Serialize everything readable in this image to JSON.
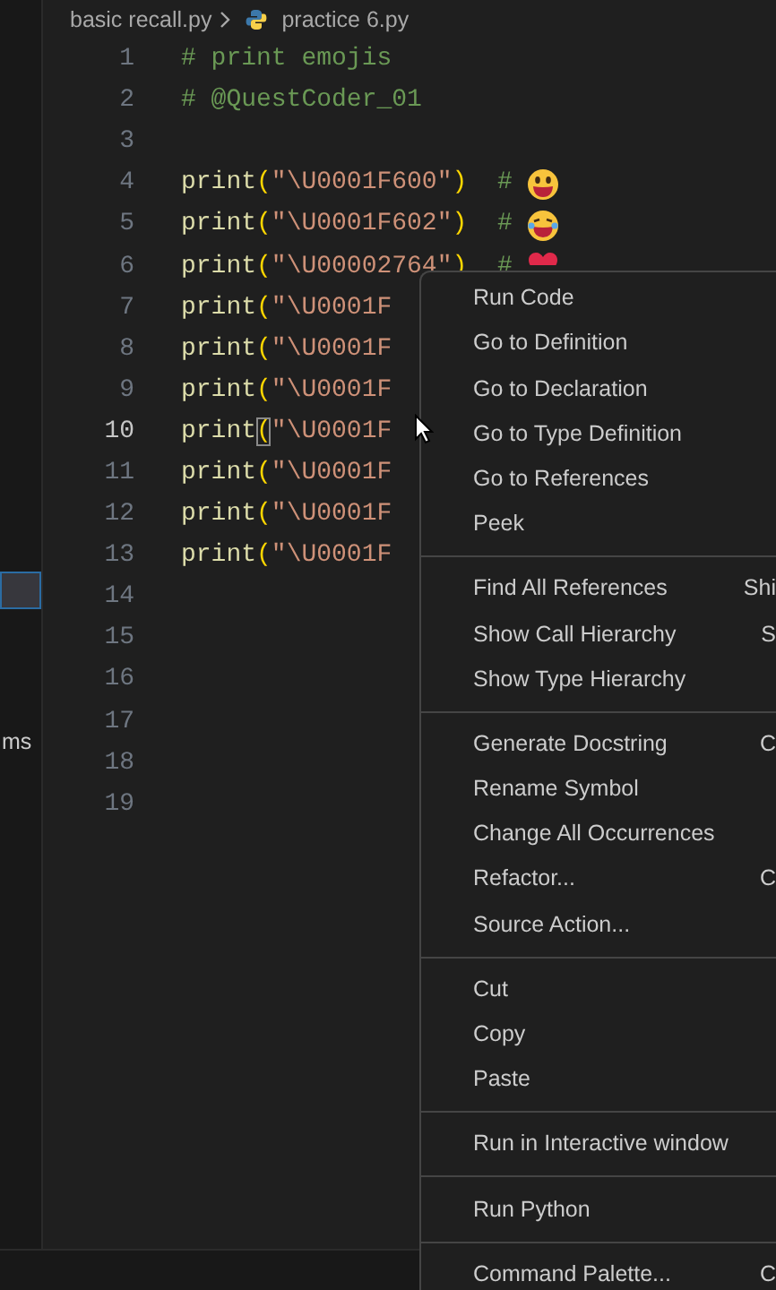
{
  "breadcrumb": {
    "folder": "basic recall.py",
    "file": "practice 6.py"
  },
  "sidebar": {
    "highlighted_row": true,
    "items": [
      {
        "label": "ms"
      }
    ]
  },
  "editor": {
    "lines": [
      {
        "number": "1",
        "current": false,
        "tokens": [
          {
            "kind": "comment",
            "text": "# print emojis"
          }
        ]
      },
      {
        "number": "2",
        "current": false,
        "tokens": [
          {
            "kind": "comment",
            "text": "# @QuestCoder_01"
          }
        ]
      },
      {
        "number": "3",
        "current": false
      },
      {
        "number": "4",
        "current": false,
        "kind": "grin",
        "tokens": [
          {
            "kind": "function",
            "text": "print"
          },
          {
            "kind": "bracket",
            "text": "("
          },
          {
            "kind": "string",
            "text": "\"\\U0001F600\""
          },
          {
            "kind": "bracket",
            "text": ")"
          },
          {
            "kind": "comment",
            "text": "  #"
          }
        ]
      },
      {
        "number": "5",
        "current": false,
        "kind": "joy",
        "tokens": [
          {
            "kind": "function",
            "text": "print"
          },
          {
            "kind": "bracket",
            "text": "("
          },
          {
            "kind": "string",
            "text": "\"\\U0001F602\""
          },
          {
            "kind": "bracket",
            "text": ")"
          },
          {
            "kind": "comment",
            "text": "  #"
          }
        ]
      },
      {
        "number": "6",
        "current": false,
        "kind": "heart",
        "tokens": [
          {
            "kind": "function",
            "text": "print"
          },
          {
            "kind": "bracket",
            "text": "("
          },
          {
            "kind": "string",
            "text": "\"\\U00002764\""
          },
          {
            "kind": "bracket",
            "text": ")"
          },
          {
            "kind": "comment",
            "text": "  #"
          }
        ]
      },
      {
        "number": "7",
        "current": false,
        "tokens": [
          {
            "kind": "function",
            "text": "print"
          },
          {
            "kind": "bracket",
            "text": "("
          },
          {
            "kind": "string",
            "text": "\"\\U0001F"
          }
        ]
      },
      {
        "number": "8",
        "current": false,
        "tokens": [
          {
            "kind": "function",
            "text": "print"
          },
          {
            "kind": "bracket",
            "text": "("
          },
          {
            "kind": "string",
            "text": "\"\\U0001F"
          }
        ]
      },
      {
        "number": "9",
        "current": false,
        "tokens": [
          {
            "kind": "function",
            "text": "print"
          },
          {
            "kind": "bracket",
            "text": "("
          },
          {
            "kind": "string",
            "text": "\"\\U0001F"
          }
        ]
      },
      {
        "number": "10",
        "current": true,
        "tokens": [
          {
            "kind": "function",
            "text": "print"
          },
          {
            "kind": "matched_bracket",
            "text": "("
          },
          {
            "kind": "string",
            "text": "\"\\U0001F"
          }
        ]
      },
      {
        "number": "11",
        "current": false,
        "tokens": [
          {
            "kind": "function",
            "text": "print"
          },
          {
            "kind": "bracket",
            "text": "("
          },
          {
            "kind": "string",
            "text": "\"\\U0001F"
          }
        ]
      },
      {
        "number": "12",
        "current": false,
        "tokens": [
          {
            "kind": "function",
            "text": "print"
          },
          {
            "kind": "bracket",
            "text": "("
          },
          {
            "kind": "string",
            "text": "\"\\U0001F"
          }
        ]
      },
      {
        "number": "13",
        "current": false,
        "tokens": [
          {
            "kind": "function",
            "text": "print"
          },
          {
            "kind": "bracket",
            "text": "("
          },
          {
            "kind": "string",
            "text": "\"\\U0001F"
          }
        ]
      },
      {
        "number": "14",
        "current": false
      },
      {
        "number": "15",
        "current": false
      },
      {
        "number": "16",
        "current": false
      },
      {
        "number": "17",
        "current": false
      },
      {
        "number": "18",
        "current": false
      },
      {
        "number": "19",
        "current": false
      }
    ]
  },
  "context_menu": {
    "groups": [
      [
        {
          "label": "Run Code"
        },
        {
          "label": "Go to Definition"
        },
        {
          "label": "Go to Declaration"
        },
        {
          "label": "Go to Type Definition"
        },
        {
          "label": "Go to References"
        },
        {
          "label": "Peek"
        }
      ],
      [
        {
          "label": "Find All References",
          "shortcut": "Shi"
        },
        {
          "label": "Show Call Hierarchy",
          "shortcut": "S"
        },
        {
          "label": "Show Type Hierarchy"
        }
      ],
      [
        {
          "label": "Generate Docstring",
          "shortcut": "C"
        },
        {
          "label": "Rename Symbol"
        },
        {
          "label": "Change All Occurrences"
        },
        {
          "label": "Refactor...",
          "shortcut": "C"
        },
        {
          "label": "Source Action..."
        }
      ],
      [
        {
          "label": "Cut"
        },
        {
          "label": "Copy"
        },
        {
          "label": "Paste"
        }
      ],
      [
        {
          "label": "Run in Interactive window"
        }
      ],
      [
        {
          "label": "Run Python"
        }
      ],
      [
        {
          "label": "Command Palette...",
          "shortcut": "C"
        }
      ]
    ]
  }
}
